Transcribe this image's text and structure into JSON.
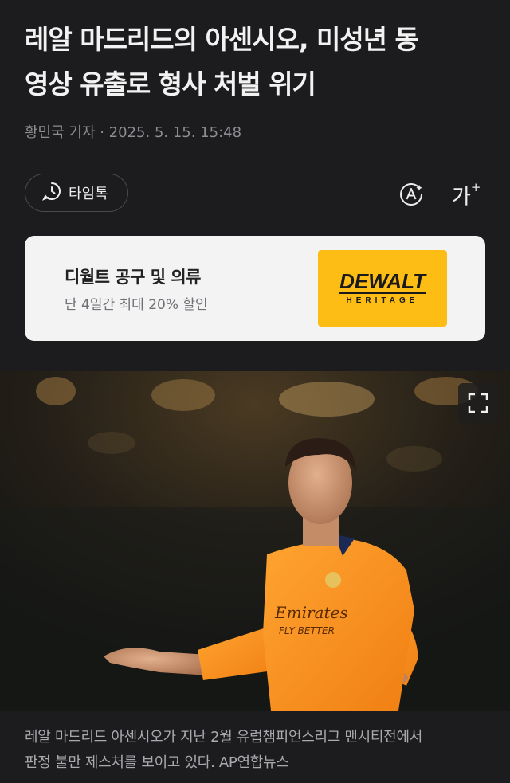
{
  "article": {
    "headline_line1": "레알 마드리드의 아센시오, 미성년 동",
    "headline_line2": "영상 유출로 형사 처벌 위기",
    "byline": "황민국 기자 · 2025. 5. 15. 15:48"
  },
  "toolbar": {
    "timetalk_label": "타임톡",
    "timetalk_icon": "clock-chat-icon",
    "ai_icon": "ai-summary-icon",
    "font_size_label": "가",
    "font_size_plus": "+"
  },
  "ad": {
    "title": "디월트 공구 및 의류",
    "subtitle": "단 4일간 최대 20% 할인",
    "logo_main": "DEWALT",
    "logo_sub": "HERITAGE",
    "logo_bg": "#fdbd15"
  },
  "photo": {
    "expand_icon": "expand-icon",
    "jersey_sponsor": "Emirates",
    "jersey_sponsor_sub": "FLY BETTER"
  },
  "caption": {
    "line1": "레알 마드리드 아센시오가 지난 2월 유럽챔피언스리그 맨시티전에서",
    "line2": "판정 불만 제스처를 보이고 있다. AP연합뉴스"
  }
}
